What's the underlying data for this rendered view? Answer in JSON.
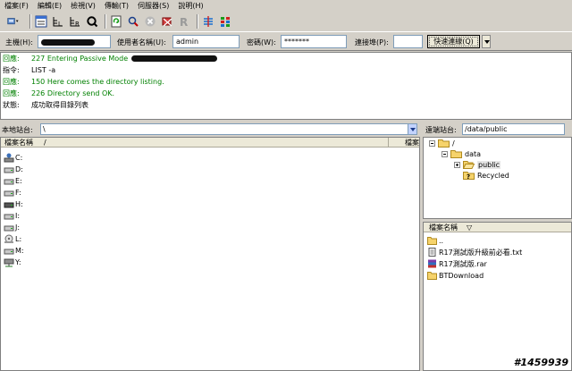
{
  "menu": [
    "檔案(F)",
    "編輯(E)",
    "檢視(V)",
    "傳輸(T)",
    "伺服器(S)",
    "說明(H)"
  ],
  "quickconnect": {
    "host_label": "主機(H):",
    "user_label": "使用者名稱(U):",
    "user_value": "admin",
    "pass_label": "密碼(W):",
    "pass_value": "*******",
    "port_label": "連接埠(P):",
    "port_value": "",
    "connect_label": "快速連線(Q)"
  },
  "log": [
    {
      "kind": "回應:",
      "text": "227 Entering Passive Mode",
      "green": true
    },
    {
      "kind": "指令:",
      "text": "LIST -a",
      "green": false
    },
    {
      "kind": "回應:",
      "text": "150 Here comes the directory listing.",
      "green": true
    },
    {
      "kind": "回應:",
      "text": "226 Directory send OK.",
      "green": true
    },
    {
      "kind": "狀態:",
      "text": "成功取得目錄列表",
      "green": false
    }
  ],
  "local": {
    "site_label": "本地站台:",
    "path": "\\",
    "col_name": "檔案名稱",
    "col_sort": "/",
    "col_right": "檔案",
    "drives": [
      "C:",
      "D:",
      "E:",
      "F:",
      "H:",
      "I:",
      "J:",
      "L:",
      "M:",
      "Y:"
    ]
  },
  "remote": {
    "site_label": "遠端站台:",
    "path": "/data/public",
    "tree": {
      "root": "/",
      "data": "data",
      "public": "public",
      "recycled": "Recycled"
    },
    "col_name": "檔案名稱",
    "col_sort": "▽",
    "files": [
      "..",
      "R17測試版升級前必看.txt",
      "R17測試版.rar",
      "BTDownload"
    ]
  },
  "watermark": "#1459939"
}
